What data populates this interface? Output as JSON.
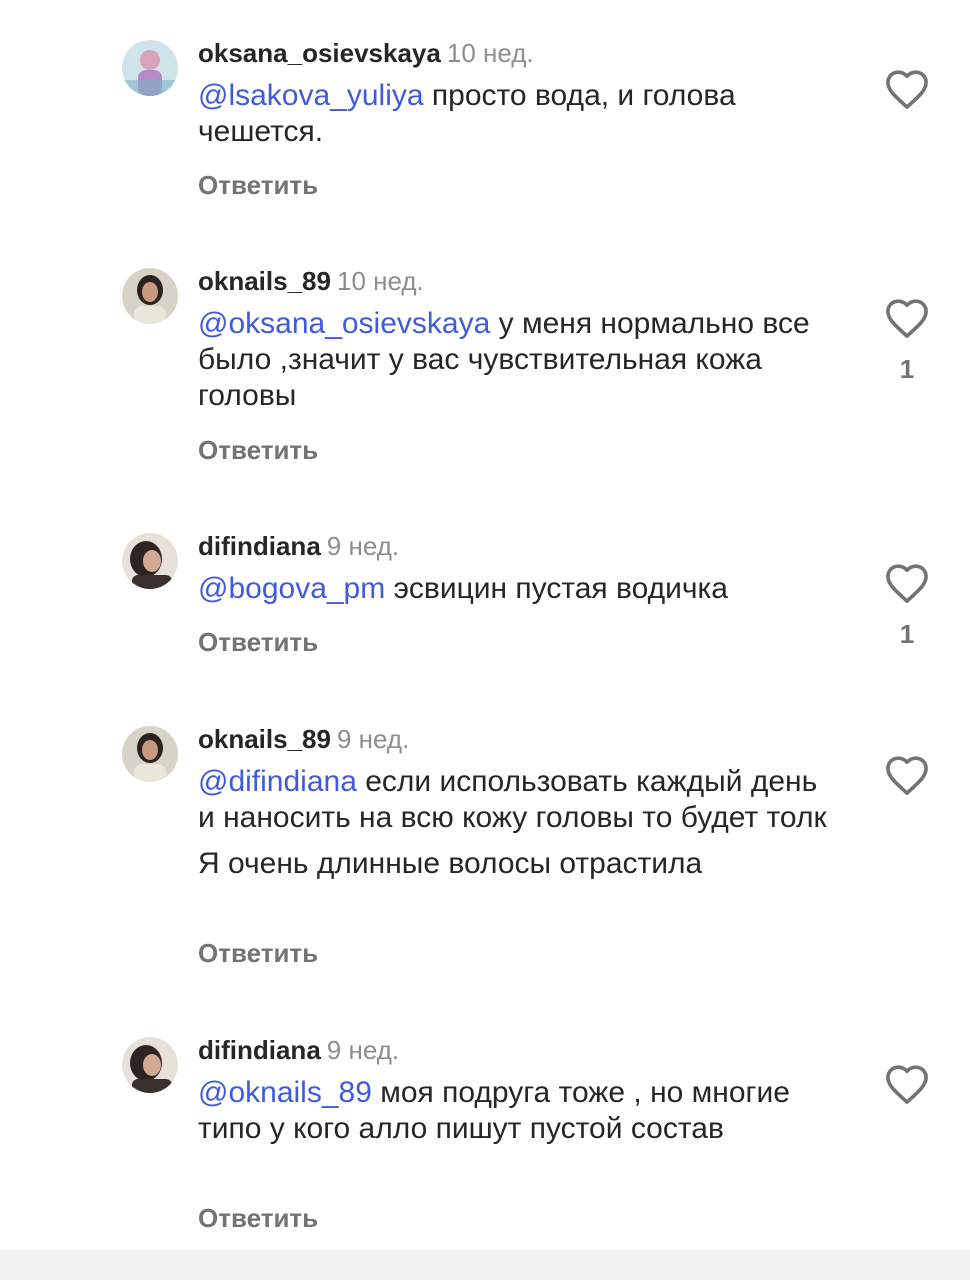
{
  "comments": [
    {
      "username": "oksana_osievskaya",
      "time": "10 нед.",
      "mention": "@lsakova_yuliya",
      "text": " просто вода, и голова чешется.",
      "reply": "Ответить",
      "likes": ""
    },
    {
      "username": "oknails_89",
      "time": "10 нед.",
      "mention": "@oksana_osievskaya",
      "text": " у меня нормально все было ,значит у вас чувствительная кожа головы",
      "reply": "Ответить",
      "likes": "1"
    },
    {
      "username": "difindiana",
      "time": "9 нед.",
      "mention": "@bogova_pm",
      "text": " эсвицин пустая водичка",
      "reply": "Ответить",
      "likes": "1"
    },
    {
      "username": "oknails_89",
      "time": "9 нед.",
      "mention": "@difindiana",
      "text": " если использовать каждый день и наносить на всю кожу головы то будет толк",
      "text2": "Я очень длинные волосы отрастила",
      "reply": "Ответить",
      "likes": ""
    },
    {
      "username": "difindiana",
      "time": "9 нед.",
      "mention": "@oknails_89",
      "text": " моя подруга тоже , но многие типо у кого алло пишут пустой состав",
      "reply": "Ответить",
      "likes": ""
    }
  ],
  "icons": {
    "like": "heart-outline-icon",
    "avatar": "profile-photo"
  },
  "colors": {
    "mention": "#3f5bd9",
    "muted": "#8e8e8e",
    "text": "#262626"
  }
}
